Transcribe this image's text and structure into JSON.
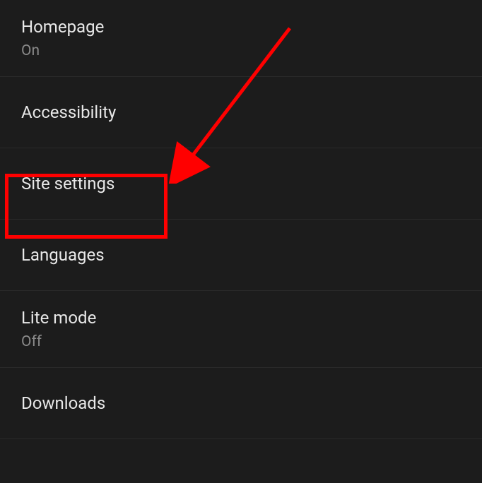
{
  "settings": {
    "homepage": {
      "title": "Homepage",
      "status": "On"
    },
    "accessibility": {
      "title": "Accessibility"
    },
    "siteSettings": {
      "title": "Site settings"
    },
    "languages": {
      "title": "Languages"
    },
    "liteMode": {
      "title": "Lite mode",
      "status": "Off"
    },
    "downloads": {
      "title": "Downloads"
    }
  }
}
